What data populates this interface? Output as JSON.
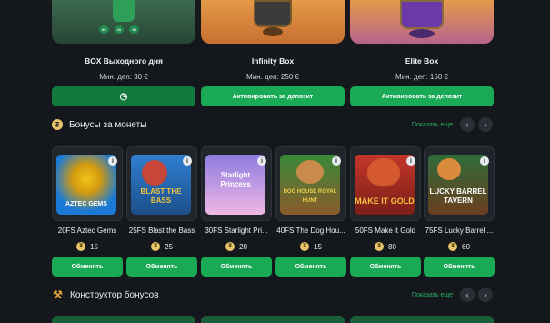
{
  "boxes": [
    {
      "title": "BOX Выходного дня",
      "deposit": "Мин. деп: 30 €",
      "button_label": "",
      "timer": [
        "65",
        "11",
        "54"
      ]
    },
    {
      "title": "Infinity Box",
      "deposit": "Мин. деп: 250 €",
      "button_label": "Активировать за депозит"
    },
    {
      "title": "Elite Box",
      "deposit": "Мин. деп: 150 €",
      "button_label": "Активировать за депозит"
    }
  ],
  "coin_bonuses": {
    "title": "Бонусы за монеты",
    "show_all": "Показать еще",
    "prev_icon": "chevron-left-icon",
    "next_icon": "chevron-right-icon",
    "cards": [
      {
        "name": "20FS Aztec Gems",
        "price": "15",
        "button_label": "Обменять",
        "art_text": "AZTEC GEMS",
        "colors": [
          "#1a7ad6",
          "#f0c419"
        ]
      },
      {
        "name": "25FS Blast the Bass",
        "price": "25",
        "button_label": "Обменять",
        "art_text": "BLAST THE BASS",
        "colors": [
          "#2f7fd0",
          "#f6c63a"
        ]
      },
      {
        "name": "30FS Starlight Pri...",
        "price": "20",
        "button_label": "Обменять",
        "art_text": "Starlight Princess",
        "colors": [
          "#8e7be0",
          "#f0b8e4"
        ]
      },
      {
        "name": "40FS The Dog Hou...",
        "price": "15",
        "button_label": "Обменять",
        "art_text": "DOG HOUSE ROYAL HUNT",
        "colors": [
          "#3a8a3a",
          "#d9a440"
        ]
      },
      {
        "name": "50FS Make it Gold",
        "price": "80",
        "button_label": "Обменять",
        "art_text": "MAKE IT GOLD",
        "colors": [
          "#c4362a",
          "#f4c542"
        ]
      },
      {
        "name": "75FS Lucky Barrel ...",
        "price": "60",
        "button_label": "Обменять",
        "art_text": "LUCKY BARREL TAVERN",
        "colors": [
          "#2f6d3a",
          "#e8b84a"
        ]
      }
    ]
  },
  "constructor": {
    "title": "Конструктор бонусов",
    "show_all": "Показать еще",
    "icon": "tools-icon"
  }
}
